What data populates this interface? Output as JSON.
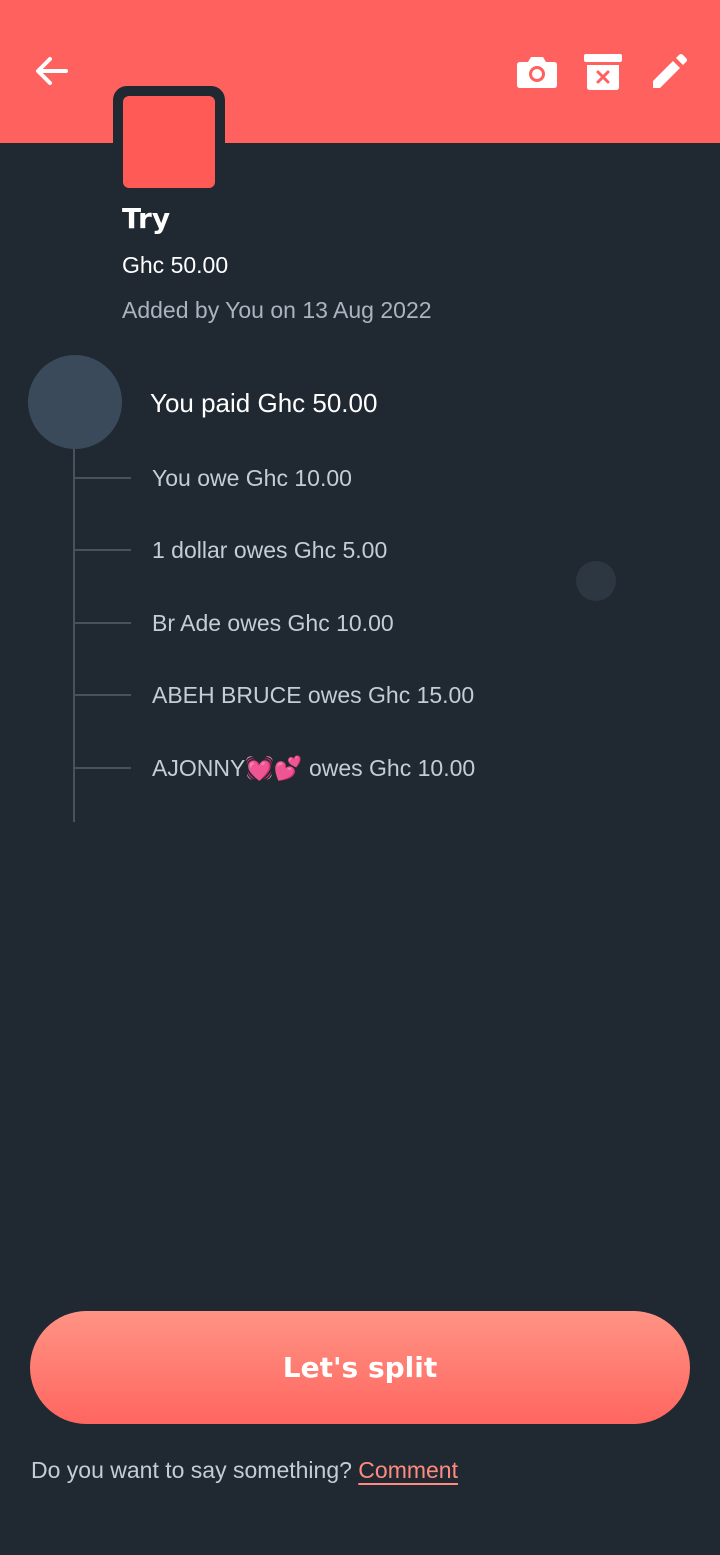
{
  "header": {
    "back_icon": "arrow-left-icon",
    "actions": [
      "camera-icon",
      "archive-delete-icon",
      "pencil-icon"
    ],
    "color": "#ff625e"
  },
  "expense": {
    "title": "Try",
    "amount": "Ghc 50.00",
    "added_by": "Added by You on 13 Aug 2022",
    "thumbnail_color": "#ff5a55"
  },
  "payer": {
    "text": "You paid Ghc 50.00"
  },
  "shares": [
    "You owe Ghc 10.00",
    "1 dollar owes Ghc 5.00",
    "Br Ade owes Ghc 10.00",
    "ABEH BRUCE owes Ghc 15.00",
    " AJONNY💓💕 owes Ghc 10.00"
  ],
  "actions": {
    "split_label": "Let's split",
    "comment_prompt": "Do you want to say something?",
    "comment_link": "Comment"
  },
  "colors": {
    "background": "#202932",
    "accent": "#ff625e",
    "link": "#ff8b80"
  }
}
